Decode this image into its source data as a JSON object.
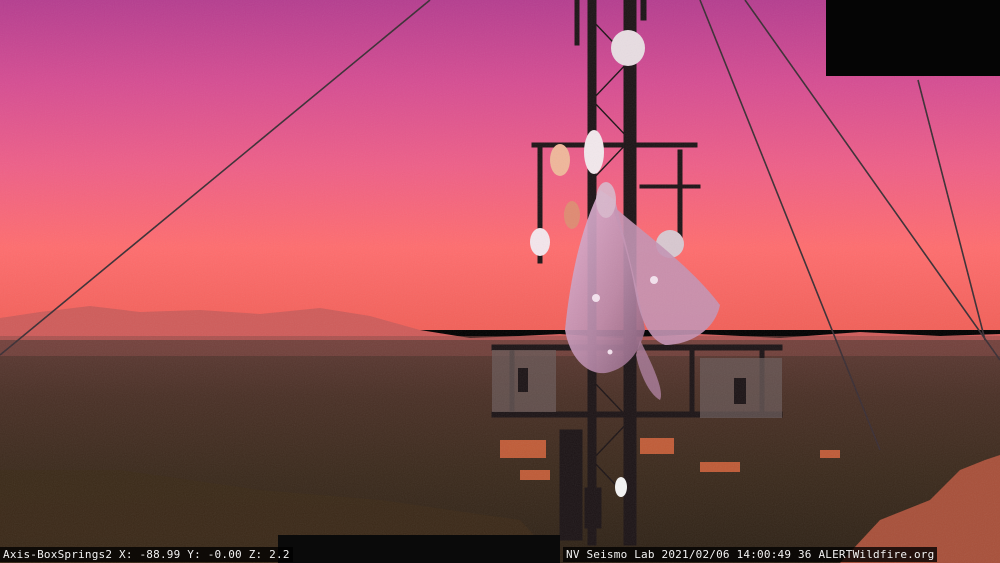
{
  "camera": {
    "name": "Axis-BoxSprings2",
    "x_label": "X",
    "x_value": "-88.99",
    "y_label": "Y",
    "y_value": "-0.00",
    "z_label": "Z",
    "z_value": "2.2",
    "timestamp": "2021/02/06 14:00:49 36",
    "operator": "NV Seismo Lab",
    "site": "ALERTWildfire.org"
  },
  "colors": {
    "sky_top": "#c2438f",
    "sky_mid": "#f0608a",
    "horizon": "#ff6e64",
    "ground": "#3a2418",
    "tower": "#1c1416"
  }
}
